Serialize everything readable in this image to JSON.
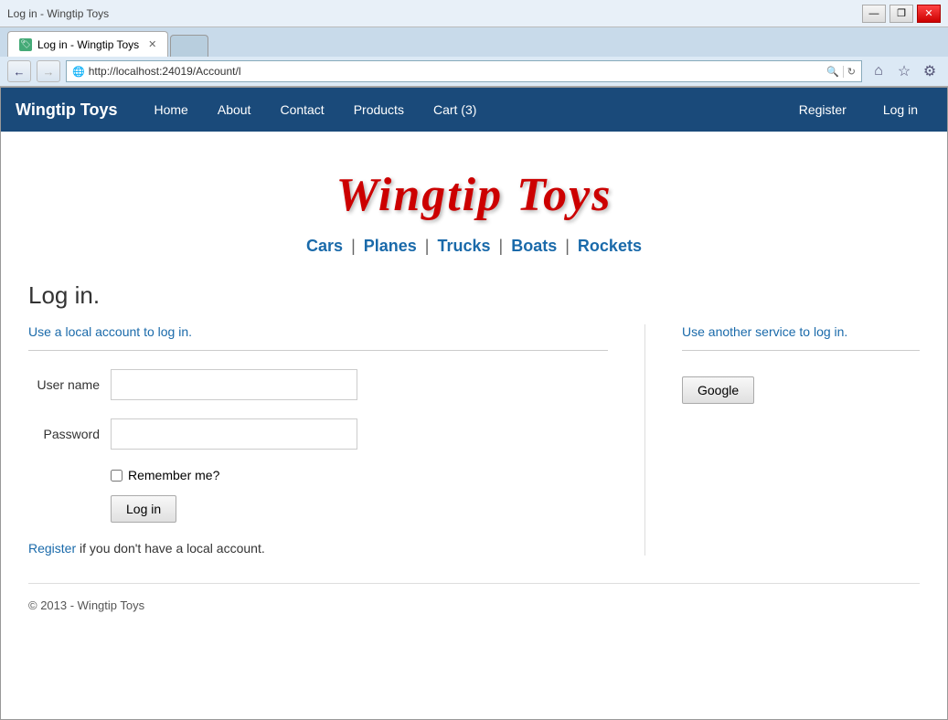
{
  "browser": {
    "url": "http://localhost:24019/Account/l",
    "tab_title": "Log in - Wingtip Toys",
    "tab_icon": "🏠"
  },
  "navbar": {
    "brand": "Wingtip Toys",
    "links": [
      {
        "label": "Home",
        "href": "#"
      },
      {
        "label": "About",
        "href": "#"
      },
      {
        "label": "Contact",
        "href": "#"
      },
      {
        "label": "Products",
        "href": "#"
      },
      {
        "label": "Cart (3)",
        "href": "#"
      }
    ],
    "right_links": [
      {
        "label": "Register",
        "href": "#"
      },
      {
        "label": "Log in",
        "href": "#"
      }
    ]
  },
  "site_title": "Wingtip Toys",
  "categories": [
    {
      "label": "Cars",
      "href": "#"
    },
    {
      "label": "Planes",
      "href": "#"
    },
    {
      "label": "Trucks",
      "href": "#"
    },
    {
      "label": "Boats",
      "href": "#"
    },
    {
      "label": "Rockets",
      "href": "#"
    }
  ],
  "login_page": {
    "title": "Log in.",
    "local_section_title": "Use a local account to log in.",
    "external_section_title": "Use another service to log in.",
    "username_label": "User name",
    "password_label": "Password",
    "remember_label": "Remember me?",
    "login_button": "Log in",
    "google_button": "Google",
    "register_text": " if you don't have a local account.",
    "register_link_text": "Register"
  },
  "footer": {
    "text": "© 2013 - Wingtip Toys"
  },
  "window_controls": {
    "minimize": "—",
    "restore": "❐",
    "close": "✕"
  }
}
